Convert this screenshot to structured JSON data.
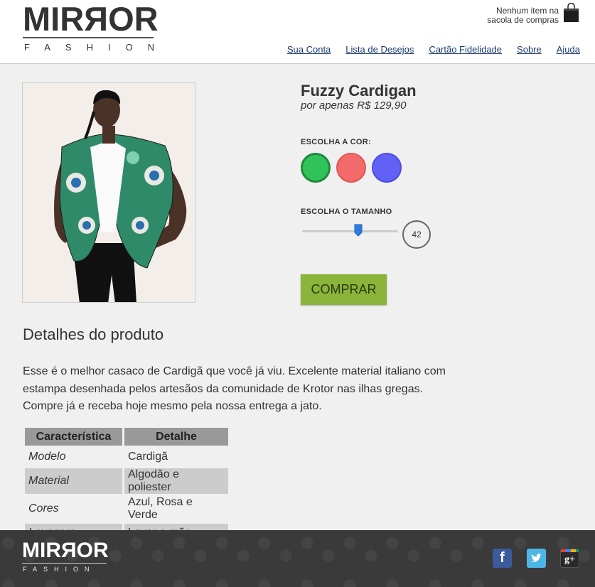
{
  "header": {
    "logo_main": "MIRROR",
    "logo_sub": "FASHION",
    "cart_line1": "Nenhum item na",
    "cart_line2": "sacola de compras",
    "nav": [
      "Sua Conta",
      "Lista de Desejos",
      "Cartão Fidelidade",
      "Sobre",
      "Ajuda"
    ]
  },
  "product": {
    "title": "Fuzzy Cardigan",
    "price": "por apenas R$ 129,90",
    "color_label": "ESCOLHA A COR:",
    "colors": [
      {
        "name": "green",
        "fill": "#2fc35a",
        "ring": "#1e8a3c",
        "selected": true
      },
      {
        "name": "red",
        "fill": "#f26a6a",
        "ring": "#e05555",
        "selected": false
      },
      {
        "name": "blue",
        "fill": "#6161f5",
        "ring": "#4c4ce0",
        "selected": false
      }
    ],
    "size_label": "ESCOLHA O TAMANHO",
    "size_value": "42",
    "buy_label": "COMPRAR",
    "accent_color": "#8ab43a"
  },
  "details": {
    "title": "Detalhes do produto",
    "text": "Esse é o melhor casaco de Cardigã que você já viu. Excelente material italiano com estampa desenhada pelos artesãos da comunidade de Krotor nas ilhas gregas. Compre já e receba hoje mesmo pela nossa entrega a jato.",
    "table": {
      "headers": [
        "Característica",
        "Detalhe"
      ],
      "rows": [
        [
          "Modelo",
          "Cardigã"
        ],
        [
          "Material",
          "Algodão e poliester"
        ],
        [
          "Cores",
          "Azul, Rosa e Verde"
        ],
        [
          "Lavagem",
          "Lavar a mão"
        ]
      ]
    }
  },
  "footer": {
    "logo_main": "MIRROR",
    "logo_sub": "FASHION",
    "social": [
      "facebook-icon",
      "twitter-icon",
      "google-plus-icon"
    ]
  }
}
